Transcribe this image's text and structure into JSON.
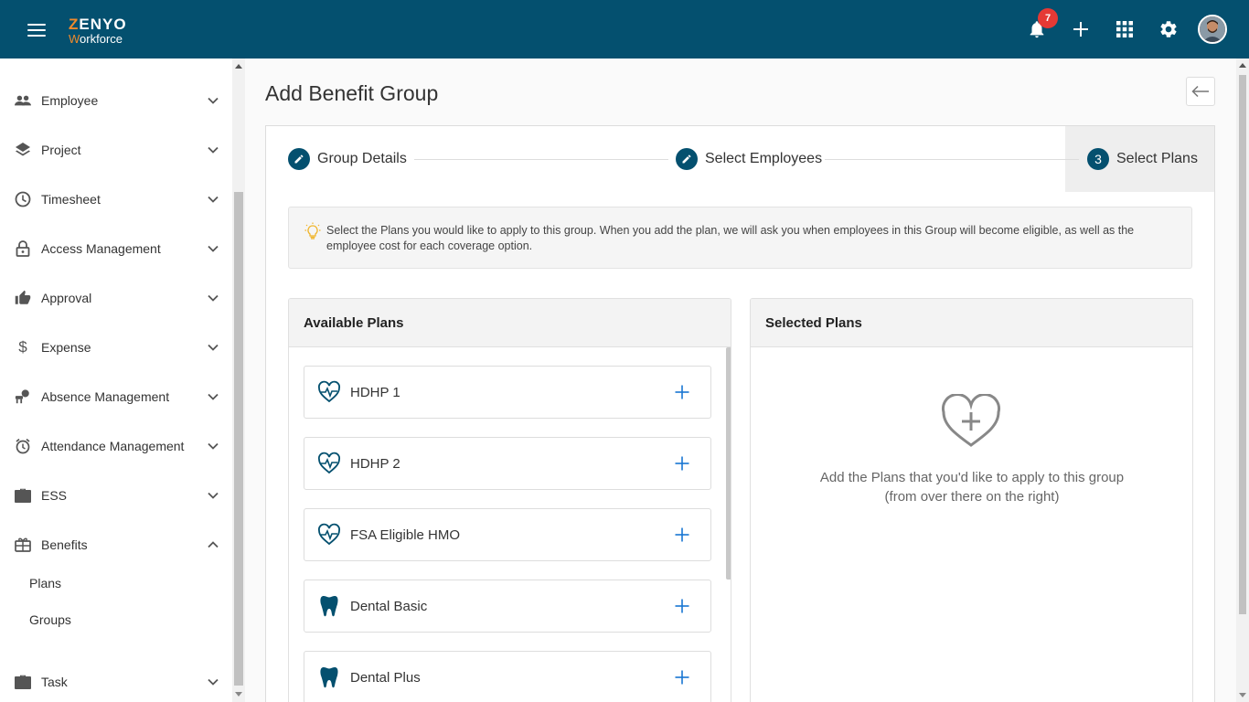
{
  "app": {
    "logo_top": "ZENYO",
    "logo_top_accent": "Z",
    "logo_top_rest": "ENYO",
    "logo_bottom_accent": "W",
    "logo_bottom_rest": "orkforce",
    "notification_count": "7",
    "colors": {
      "primary": "#04506f",
      "accent": "#f08a2c",
      "badge": "#e53935",
      "add_icon": "#1976d2"
    },
    "icons": [
      "menu-icon",
      "bell-icon",
      "plus-icon",
      "apps-grid-icon",
      "gear-icon",
      "avatar"
    ]
  },
  "sidebar": {
    "items": [
      {
        "label": "Employee",
        "icon": "people-icon",
        "expanded": false
      },
      {
        "label": "Project",
        "icon": "layers-icon",
        "expanded": false
      },
      {
        "label": "Timesheet",
        "icon": "clock-icon",
        "expanded": false
      },
      {
        "label": "Access Management",
        "icon": "lock-icon",
        "expanded": false
      },
      {
        "label": "Approval",
        "icon": "thumbs-up-icon",
        "expanded": false
      },
      {
        "label": "Expense",
        "icon": "dollar-icon",
        "expanded": false
      },
      {
        "label": "Absence Management",
        "icon": "absence-icon",
        "expanded": false
      },
      {
        "label": "Attendance Management",
        "icon": "alarm-icon",
        "expanded": false
      },
      {
        "label": "ESS",
        "icon": "briefcase-icon",
        "expanded": false
      },
      {
        "label": "Benefits",
        "icon": "gift-icon",
        "expanded": true
      },
      {
        "label": "Task",
        "icon": "briefcase-icon",
        "expanded": false
      }
    ],
    "benefits_sub": [
      "Plans",
      "Groups"
    ]
  },
  "main": {
    "title": "Add Benefit Group",
    "steps": [
      {
        "label": "Group Details",
        "marker": "edit-icon"
      },
      {
        "label": "Select Employees",
        "marker": "edit-icon"
      },
      {
        "label": "Select Plans",
        "number": "3"
      }
    ],
    "info_text": "Select the Plans you would like to apply to this group. When you add the plan, we will ask you when employees in this Group will become eligible, as well as the employee cost for each coverage option.",
    "available": {
      "title": "Available Plans",
      "plans": [
        {
          "name": "HDHP 1",
          "icon": "heart-pulse-icon"
        },
        {
          "name": "HDHP 2",
          "icon": "heart-pulse-icon"
        },
        {
          "name": "FSA Eligible HMO",
          "icon": "heart-pulse-icon"
        },
        {
          "name": "Dental Basic",
          "icon": "tooth-icon"
        },
        {
          "name": "Dental Plus",
          "icon": "tooth-icon"
        }
      ]
    },
    "selected": {
      "title": "Selected Plans",
      "empty_line1": "Add the Plans that you'd like to apply to this group",
      "empty_line2": "(from over there on the right)"
    }
  }
}
